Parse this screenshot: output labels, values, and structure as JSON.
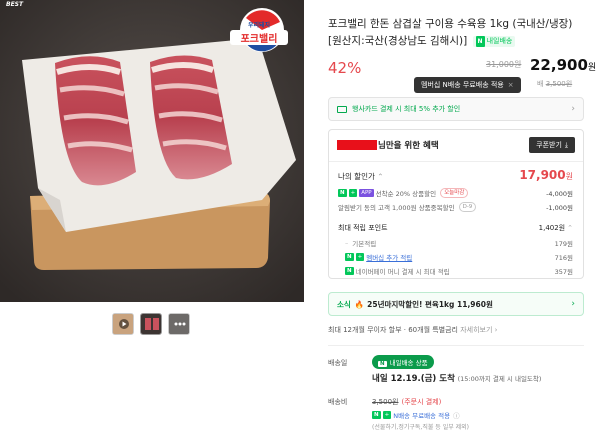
{
  "badge": "BEST",
  "brand_logo": {
    "small": "우리돼지",
    "big": "포크밸리"
  },
  "title": "포크밸리 한돈 삼겹살 구이용 수육용 1kg (국내산/냉장) [원산지:국산(경상남도 김해시)]",
  "title_tag": "내일배송",
  "price": {
    "discount_rate": "42%",
    "original": "31,000원",
    "sale": "22,900",
    "sale_unit": "원"
  },
  "tooltip": {
    "text": "멤버십 N배송 무료배송 적용",
    "close": "×"
  },
  "delivery_fee": {
    "label": "배",
    "value": "3,500원"
  },
  "card_promo": {
    "text": "행사카드 결제 시 최대 5% 추가 할인",
    "chevron": "›"
  },
  "benefit": {
    "heading_suffix": "님만을 위한 혜택",
    "coupon_button": "쿠폰받기",
    "my_discount_label": "나의 할인가",
    "my_discount_price": "17,900",
    "my_discount_unit": "원",
    "discount_rows": [
      {
        "tags": [
          "N",
          "+",
          "APP"
        ],
        "text": "선착순 20% 상품할인",
        "pill": "오늘마감",
        "value": "-4,000원"
      },
      {
        "text": "알림받기 동의 고객 1,000원 상품중복할인",
        "pill": "D-9",
        "value": "-1,000원"
      }
    ],
    "points_label": "최대 적립 포인트",
    "points_value": "1,402원",
    "point_rows": [
      {
        "text": "기본적립",
        "value": "179원"
      },
      {
        "tags": [
          "N",
          "+"
        ],
        "text": "멤버십 추가 적립",
        "value": "716원"
      },
      {
        "tags": [
          "N"
        ],
        "text": "네이버페이 머니 결제 시 최대 적립",
        "value": "357원"
      }
    ]
  },
  "news": {
    "label": "소식",
    "text": "25년마지막할인! 편육1kg 11,960원",
    "chevron": "›"
  },
  "installment": {
    "text": "최대 12개월 무이자 할부 · 60개월 특별금리",
    "link": "자세히보기 ›"
  },
  "shipping": {
    "label": "배송일",
    "chip": "내일배송 상품",
    "chip_n": "N",
    "arrival": "내일 12.19.(금) 도착",
    "cutoff": "(15:00까지 결제 시 내일도착)"
  },
  "fee": {
    "label": "배송비",
    "value": "3,500원",
    "condition": "(주문시 결제)",
    "membership": "N배송 무료배송 적용",
    "note": "(선물하기,정기구독,직불 등 일부 제외)"
  },
  "colors": {
    "accent_red": "#e5484d",
    "naver_green": "#03c75a",
    "app_purple": "#7b52e0"
  }
}
